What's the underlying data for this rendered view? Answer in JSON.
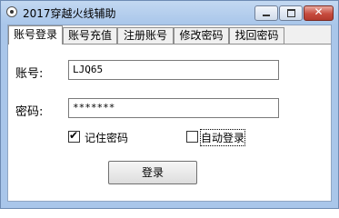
{
  "window": {
    "title": "2017穿越火线辅助",
    "icon": "app-icon",
    "controls": {
      "minimize_icon": "minimize-icon",
      "maximize_icon": "maximize-icon",
      "close_glyph": "✕"
    }
  },
  "tabs": [
    {
      "label": "账号登录",
      "active": true
    },
    {
      "label": "账号充值",
      "active": false
    },
    {
      "label": "注册账号",
      "active": false
    },
    {
      "label": "修改密码",
      "active": false
    },
    {
      "label": "找回密码",
      "active": false
    }
  ],
  "form": {
    "account_label": "账号:",
    "account_value": "LJQ65",
    "password_label": "密码:",
    "password_value": "*******",
    "remember_label": "记住密码",
    "remember_checked": true,
    "remember_mark": "✔",
    "auto_login_label": "自动登录",
    "auto_login_checked": false,
    "login_button_label": "登录"
  }
}
